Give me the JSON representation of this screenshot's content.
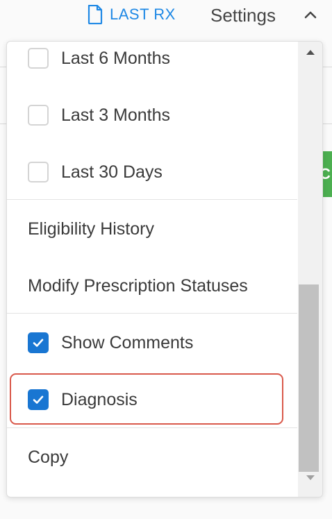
{
  "header": {
    "last_rx_label": "LAST RX",
    "settings_label": "Settings"
  },
  "background": {
    "green_fragment_text": "C"
  },
  "menu": {
    "items": [
      {
        "label": "Last 6 Months",
        "type": "checkbox",
        "checked": false
      },
      {
        "label": "Last 3 Months",
        "type": "checkbox",
        "checked": false
      },
      {
        "label": "Last 30 Days",
        "type": "checkbox",
        "checked": false
      },
      {
        "label": "Eligibility History",
        "type": "action"
      },
      {
        "label": "Modify Prescription Statuses",
        "type": "action"
      },
      {
        "label": "Show Comments",
        "type": "checkbox",
        "checked": true
      },
      {
        "label": "Diagnosis",
        "type": "checkbox",
        "checked": true,
        "highlighted": true
      },
      {
        "label": "Copy",
        "type": "action"
      }
    ]
  },
  "colors": {
    "accent": "#1976d2",
    "link": "#1e88e5",
    "highlight_border": "#d9584a",
    "green": "#4caf50"
  },
  "icons": {
    "last_rx": "document-icon",
    "settings_toggle": "chevron-up-icon",
    "scroll_up": "triangle-up-icon",
    "scroll_down": "triangle-down-icon",
    "checkmark": "checkmark-icon"
  }
}
